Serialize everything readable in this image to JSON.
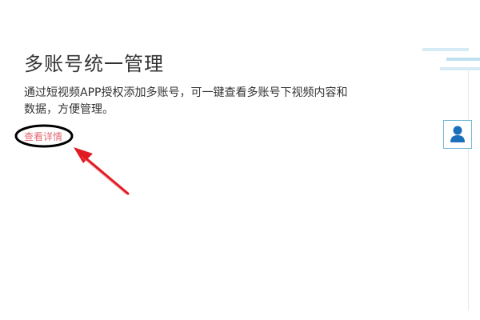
{
  "feature": {
    "title": "多账号统一管理",
    "description": "通过短视频APP授权添加多账号，可一键查看多账号下视频内容和数据，方便管理。",
    "details_link": "查看详情"
  },
  "colors": {
    "title_text": "#333333",
    "link_text": "#e06a73",
    "annotation_arrow": "#e11b22",
    "annotation_ellipse": "#000000",
    "accent_blue": "#1a6fbb",
    "deco_light_blue": "#cfe6f3"
  },
  "icons": {
    "decor": "menu-lines-icon",
    "account": "user-avatar-icon"
  }
}
